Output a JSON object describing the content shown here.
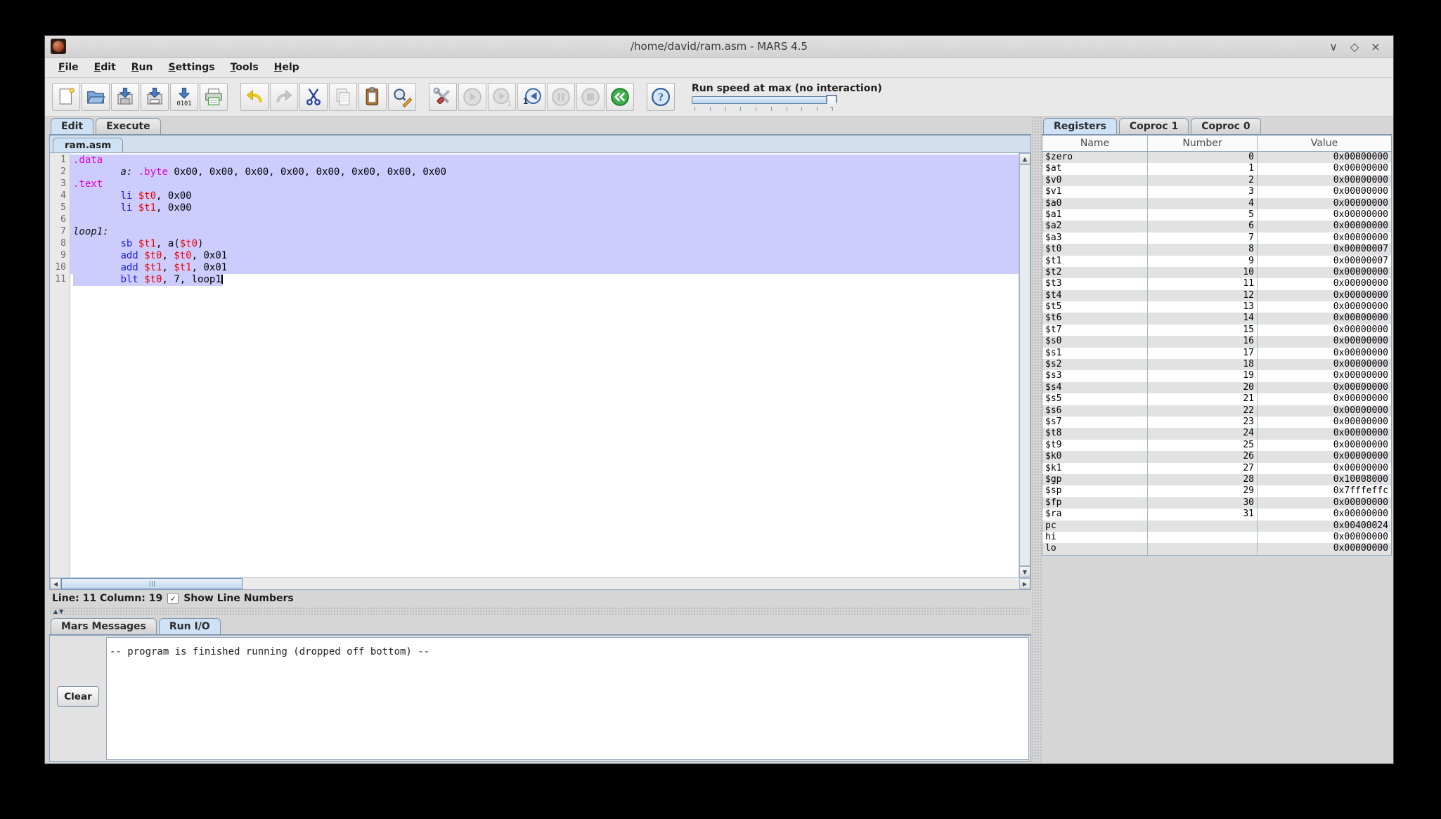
{
  "window": {
    "title": "/home/david/ram.asm - MARS 4.5",
    "controls": [
      {
        "name": "minimize",
        "glyph": "∨"
      },
      {
        "name": "maximize",
        "glyph": "◇"
      },
      {
        "name": "close",
        "glyph": "×"
      }
    ]
  },
  "menu": {
    "items": [
      {
        "label": "File",
        "mnemonic": 0
      },
      {
        "label": "Edit",
        "mnemonic": 0
      },
      {
        "label": "Run",
        "mnemonic": 0
      },
      {
        "label": "Settings",
        "mnemonic": 0
      },
      {
        "label": "Tools",
        "mnemonic": 0
      },
      {
        "label": "Help",
        "mnemonic": 0
      }
    ]
  },
  "toolbar": {
    "run_speed_label": "Run speed at max (no interaction)",
    "tick_count": 10,
    "buttons": [
      {
        "name": "new-file",
        "icon": "new",
        "enabled": true,
        "gap": false
      },
      {
        "name": "open-file",
        "icon": "open",
        "enabled": true,
        "gap": false
      },
      {
        "name": "save",
        "icon": "save",
        "enabled": true,
        "gap": false
      },
      {
        "name": "save-as",
        "icon": "saveas",
        "enabled": true,
        "gap": false
      },
      {
        "name": "dump-memory",
        "icon": "dump",
        "enabled": true,
        "gap": false
      },
      {
        "name": "print",
        "icon": "print",
        "enabled": true,
        "gap": false
      },
      {
        "name": "undo",
        "icon": "undo",
        "enabled": true,
        "gap": true
      },
      {
        "name": "redo",
        "icon": "redo",
        "enabled": false,
        "gap": false
      },
      {
        "name": "cut",
        "icon": "cut",
        "enabled": true,
        "gap": false
      },
      {
        "name": "copy",
        "icon": "copy",
        "enabled": false,
        "gap": false
      },
      {
        "name": "paste",
        "icon": "paste",
        "enabled": true,
        "gap": false
      },
      {
        "name": "find-replace",
        "icon": "find",
        "enabled": true,
        "gap": false
      },
      {
        "name": "assemble",
        "icon": "assemble",
        "enabled": true,
        "gap": true
      },
      {
        "name": "run",
        "icon": "run",
        "enabled": false,
        "gap": false
      },
      {
        "name": "step",
        "icon": "step",
        "enabled": false,
        "gap": false
      },
      {
        "name": "backstep",
        "icon": "backstep",
        "enabled": true,
        "gap": false
      },
      {
        "name": "pause",
        "icon": "pause",
        "enabled": false,
        "gap": false
      },
      {
        "name": "stop",
        "icon": "stop",
        "enabled": false,
        "gap": false
      },
      {
        "name": "reset",
        "icon": "reset",
        "enabled": true,
        "gap": false
      },
      {
        "name": "help",
        "icon": "help",
        "enabled": true,
        "gap": true
      }
    ]
  },
  "main_tabs": [
    {
      "label": "Edit",
      "selected": true
    },
    {
      "label": "Execute",
      "selected": false
    }
  ],
  "editor": {
    "file_tab": "ram.asm",
    "lines": [
      {
        "n": "1",
        "hl": "full",
        "segs": [
          [
            "d",
            ".data"
          ]
        ]
      },
      {
        "n": "2",
        "hl": "full",
        "segs": [
          [
            "p",
            "        "
          ],
          [
            "l",
            "a:"
          ],
          [
            "p",
            " "
          ],
          [
            "d",
            ".byte"
          ],
          [
            "p",
            " 0x00, 0x00, 0x00, 0x00, 0x00, 0x00, 0x00, 0x00"
          ]
        ]
      },
      {
        "n": "3",
        "hl": "full",
        "segs": [
          [
            "d",
            ".text"
          ]
        ]
      },
      {
        "n": "4",
        "hl": "full",
        "segs": [
          [
            "p",
            "        "
          ],
          [
            "i",
            "li"
          ],
          [
            "p",
            " "
          ],
          [
            "r",
            "$t0"
          ],
          [
            "p",
            ", 0x00"
          ]
        ]
      },
      {
        "n": "5",
        "hl": "full",
        "segs": [
          [
            "p",
            "        "
          ],
          [
            "i",
            "li"
          ],
          [
            "p",
            " "
          ],
          [
            "r",
            "$t1"
          ],
          [
            "p",
            ", 0x00"
          ]
        ]
      },
      {
        "n": "6",
        "hl": "full",
        "segs": []
      },
      {
        "n": "7",
        "hl": "full",
        "segs": [
          [
            "l",
            "loop1:"
          ]
        ]
      },
      {
        "n": "8",
        "hl": "full",
        "segs": [
          [
            "p",
            "        "
          ],
          [
            "i",
            "sb"
          ],
          [
            "p",
            " "
          ],
          [
            "r",
            "$t1"
          ],
          [
            "p",
            ", a("
          ],
          [
            "r",
            "$t0"
          ],
          [
            "p",
            ")"
          ]
        ]
      },
      {
        "n": "9",
        "hl": "full",
        "segs": [
          [
            "p",
            "        "
          ],
          [
            "i",
            "add"
          ],
          [
            "p",
            " "
          ],
          [
            "r",
            "$t0"
          ],
          [
            "p",
            ", "
          ],
          [
            "r",
            "$t0"
          ],
          [
            "p",
            ", 0x01"
          ]
        ]
      },
      {
        "n": "10",
        "hl": "full",
        "segs": [
          [
            "p",
            "        "
          ],
          [
            "i",
            "add"
          ],
          [
            "p",
            " "
          ],
          [
            "r",
            "$t1"
          ],
          [
            "p",
            ", "
          ],
          [
            "r",
            "$t1"
          ],
          [
            "p",
            ", 0x01"
          ]
        ]
      },
      {
        "n": "11",
        "hl": "caret",
        "segs": [
          [
            "p",
            "        "
          ],
          [
            "i",
            "blt"
          ],
          [
            "p",
            " "
          ],
          [
            "r",
            "$t0"
          ],
          [
            "p",
            ", 7, loop1"
          ]
        ]
      }
    ],
    "status": {
      "line_col": "Line: 11 Column: 19",
      "show_line_numbers_label": "Show Line Numbers",
      "show_line_numbers_checked": true,
      "check_glyph": "✓"
    }
  },
  "registers_panel": {
    "tabs": [
      {
        "label": "Registers",
        "selected": true
      },
      {
        "label": "Coproc 1",
        "selected": false
      },
      {
        "label": "Coproc 0",
        "selected": false
      }
    ],
    "columns": [
      "Name",
      "Number",
      "Value"
    ],
    "rows": [
      [
        "$zero",
        "0",
        "0x00000000"
      ],
      [
        "$at",
        "1",
        "0x00000000"
      ],
      [
        "$v0",
        "2",
        "0x00000000"
      ],
      [
        "$v1",
        "3",
        "0x00000000"
      ],
      [
        "$a0",
        "4",
        "0x00000000"
      ],
      [
        "$a1",
        "5",
        "0x00000000"
      ],
      [
        "$a2",
        "6",
        "0x00000000"
      ],
      [
        "$a3",
        "7",
        "0x00000000"
      ],
      [
        "$t0",
        "8",
        "0x00000007"
      ],
      [
        "$t1",
        "9",
        "0x00000007"
      ],
      [
        "$t2",
        "10",
        "0x00000000"
      ],
      [
        "$t3",
        "11",
        "0x00000000"
      ],
      [
        "$t4",
        "12",
        "0x00000000"
      ],
      [
        "$t5",
        "13",
        "0x00000000"
      ],
      [
        "$t6",
        "14",
        "0x00000000"
      ],
      [
        "$t7",
        "15",
        "0x00000000"
      ],
      [
        "$s0",
        "16",
        "0x00000000"
      ],
      [
        "$s1",
        "17",
        "0x00000000"
      ],
      [
        "$s2",
        "18",
        "0x00000000"
      ],
      [
        "$s3",
        "19",
        "0x00000000"
      ],
      [
        "$s4",
        "20",
        "0x00000000"
      ],
      [
        "$s5",
        "21",
        "0x00000000"
      ],
      [
        "$s6",
        "22",
        "0x00000000"
      ],
      [
        "$s7",
        "23",
        "0x00000000"
      ],
      [
        "$t8",
        "24",
        "0x00000000"
      ],
      [
        "$t9",
        "25",
        "0x00000000"
      ],
      [
        "$k0",
        "26",
        "0x00000000"
      ],
      [
        "$k1",
        "27",
        "0x00000000"
      ],
      [
        "$gp",
        "28",
        "0x10008000"
      ],
      [
        "$sp",
        "29",
        "0x7fffeffc"
      ],
      [
        "$fp",
        "30",
        "0x00000000"
      ],
      [
        "$ra",
        "31",
        "0x00000000"
      ],
      [
        "pc",
        "",
        "0x00400024"
      ],
      [
        "hi",
        "",
        "0x00000000"
      ],
      [
        "lo",
        "",
        "0x00000000"
      ]
    ]
  },
  "bottom_panel": {
    "tabs": [
      {
        "label": "Mars Messages",
        "selected": false
      },
      {
        "label": "Run I/O",
        "selected": true
      }
    ],
    "clear_label": "Clear",
    "message": "-- program is finished running (dropped off bottom) --"
  },
  "colors": {
    "selection": "#ccccff",
    "tab_selected": "#cfe2f5",
    "directive": "#dd00dd",
    "instruction": "#1a1ae6",
    "register": "#ee0000",
    "row_alt": "#e2e2e2",
    "slider_fill": "#b9d2ec"
  }
}
